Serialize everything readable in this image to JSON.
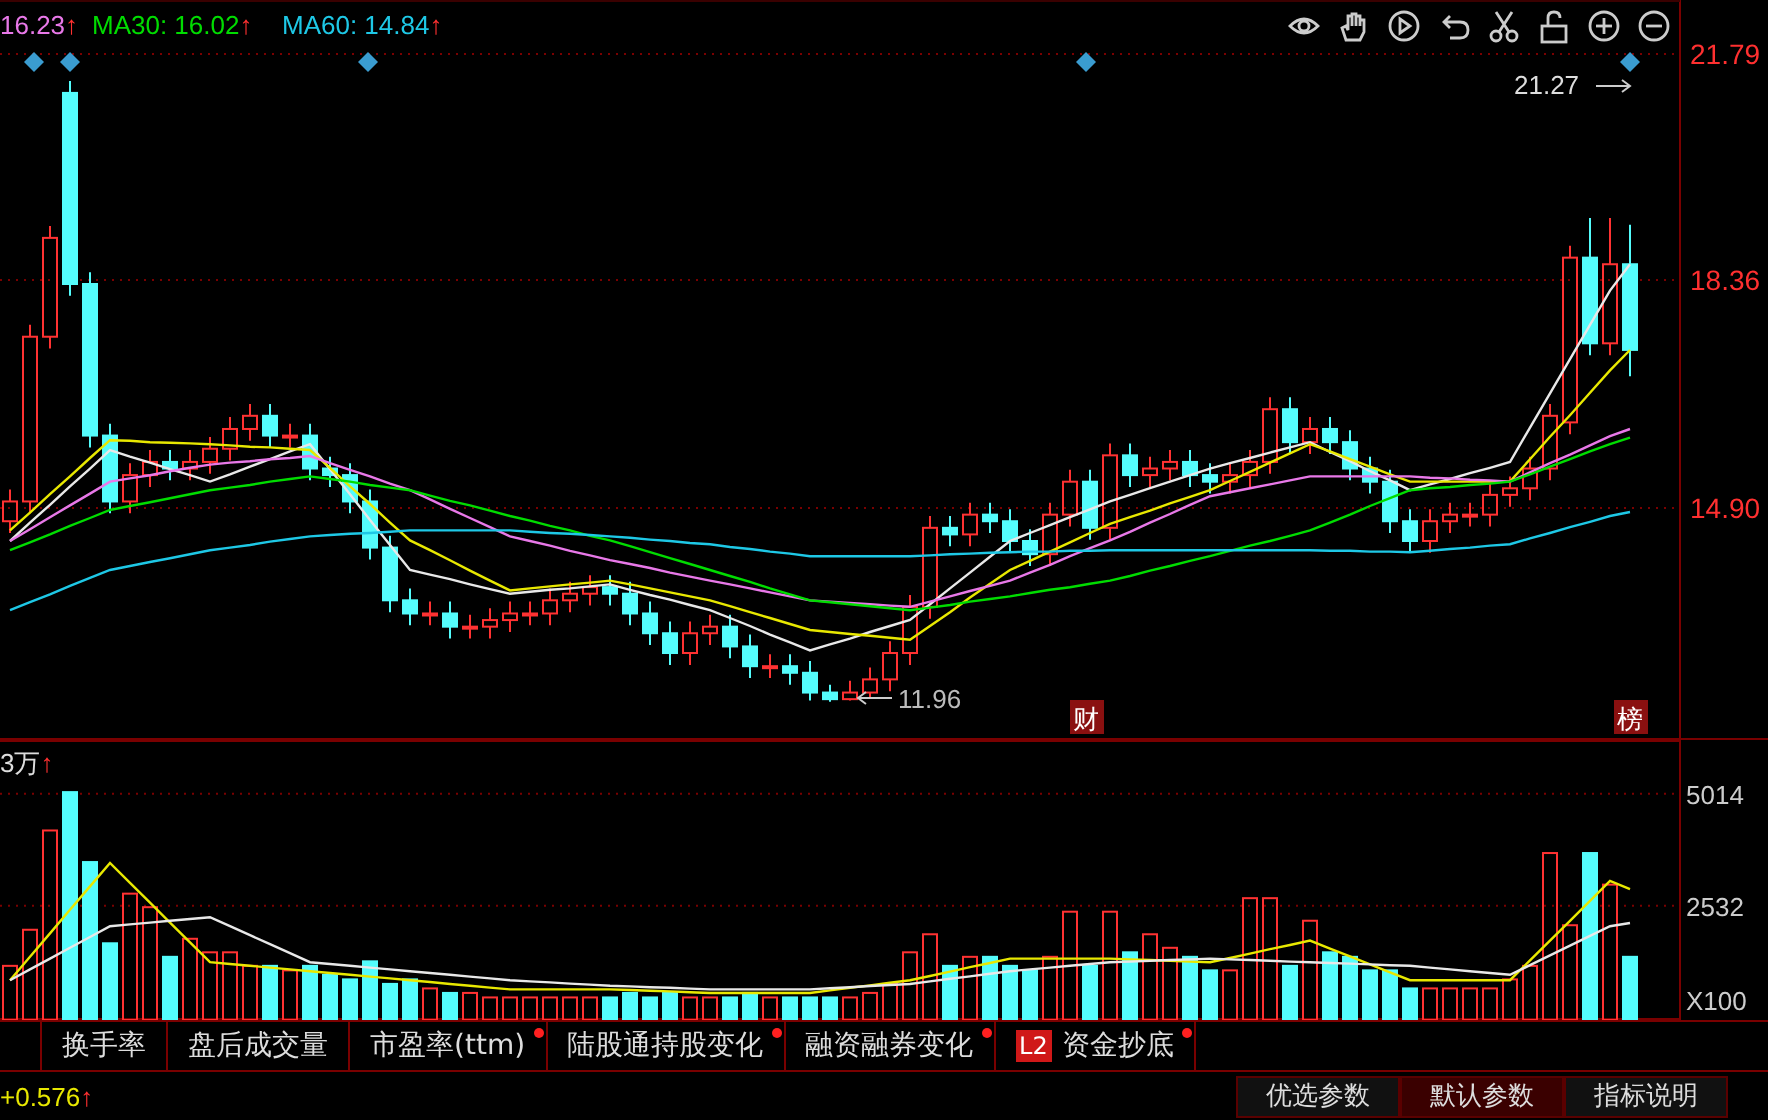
{
  "legend": [
    {
      "text": "16.23",
      "arrow": "↑",
      "color": "#e878e8"
    },
    {
      "text": "MA30: 16.02",
      "arrow": "↑",
      "color": "#00dc00"
    },
    {
      "text": "MA60: 14.84",
      "arrow": "↑",
      "color": "#1ec8e6"
    }
  ],
  "price_chart": {
    "chart_data": {
      "type": "candlestick",
      "ylim": [
        11.38,
        22.61
      ],
      "yticks": [
        {
          "value": 21.79,
          "label": "21.79"
        },
        {
          "value": 18.36,
          "label": "18.36"
        },
        {
          "value": 14.9,
          "label": "14.90"
        }
      ],
      "categories": [
        null,
        null,
        null,
        null,
        null,
        null,
        null,
        null,
        null,
        null,
        null,
        null,
        null,
        null,
        null,
        null,
        null,
        null,
        null,
        null,
        null,
        null,
        null,
        null,
        null,
        null,
        null,
        null,
        null,
        null,
        null,
        null,
        null,
        null,
        null,
        null,
        null,
        null,
        null,
        null,
        null,
        null,
        null,
        null,
        null,
        null,
        null,
        null,
        null,
        null,
        null,
        null,
        null,
        null,
        null,
        null,
        null,
        null,
        null,
        null,
        null,
        null,
        null,
        null,
        null,
        null,
        null,
        null,
        null,
        null,
        null,
        null,
        null,
        null,
        null,
        null,
        null,
        null,
        null,
        null,
        null,
        null
      ],
      "ohlc": [
        [
          14.7,
          15.18,
          14.52,
          15.0
        ],
        [
          15.0,
          17.68,
          14.82,
          17.5
        ],
        [
          17.5,
          19.18,
          17.32,
          19.0
        ],
        [
          21.2,
          21.38,
          18.12,
          18.3
        ],
        [
          18.3,
          18.48,
          15.82,
          16.0
        ],
        [
          16.0,
          16.18,
          14.82,
          15.0
        ],
        [
          15.0,
          15.58,
          14.82,
          15.4
        ],
        [
          15.4,
          15.78,
          15.22,
          15.6
        ],
        [
          15.6,
          15.78,
          15.32,
          15.5
        ],
        [
          15.5,
          15.78,
          15.32,
          15.6
        ],
        [
          15.6,
          15.98,
          15.42,
          15.8
        ],
        [
          15.8,
          16.28,
          15.62,
          16.1
        ],
        [
          16.1,
          16.48,
          15.92,
          16.3
        ],
        [
          16.3,
          16.48,
          15.82,
          16.0
        ],
        [
          16.0,
          16.18,
          15.82,
          16.0
        ],
        [
          16.0,
          16.18,
          15.32,
          15.5
        ],
        [
          15.5,
          15.68,
          15.22,
          15.4
        ],
        [
          15.4,
          15.58,
          14.82,
          15.0
        ],
        [
          15.0,
          15.18,
          14.12,
          14.3
        ],
        [
          14.3,
          14.48,
          13.32,
          13.5
        ],
        [
          13.5,
          13.68,
          13.12,
          13.3
        ],
        [
          13.3,
          13.48,
          13.12,
          13.3
        ],
        [
          13.3,
          13.48,
          12.92,
          13.1
        ],
        [
          13.1,
          13.28,
          12.92,
          13.1
        ],
        [
          13.1,
          13.38,
          12.92,
          13.2
        ],
        [
          13.2,
          13.48,
          13.02,
          13.3
        ],
        [
          13.3,
          13.48,
          13.12,
          13.3
        ],
        [
          13.3,
          13.68,
          13.12,
          13.5
        ],
        [
          13.5,
          13.78,
          13.32,
          13.6
        ],
        [
          13.6,
          13.88,
          13.42,
          13.7
        ],
        [
          13.7,
          13.88,
          13.42,
          13.6
        ],
        [
          13.6,
          13.78,
          13.12,
          13.3
        ],
        [
          13.3,
          13.48,
          12.82,
          13.0
        ],
        [
          13.0,
          13.18,
          12.52,
          12.7
        ],
        [
          12.7,
          13.18,
          12.52,
          13.0
        ],
        [
          13.0,
          13.28,
          12.82,
          13.1
        ],
        [
          13.1,
          13.28,
          12.62,
          12.8
        ],
        [
          12.8,
          12.98,
          12.32,
          12.5
        ],
        [
          12.5,
          12.68,
          12.32,
          12.5
        ],
        [
          12.5,
          12.68,
          12.22,
          12.4
        ],
        [
          12.4,
          12.58,
          11.98,
          12.1
        ],
        [
          12.1,
          12.22,
          11.96,
          12.0
        ],
        [
          12.0,
          12.28,
          11.98,
          12.1
        ],
        [
          12.1,
          12.48,
          12.02,
          12.3
        ],
        [
          12.3,
          12.88,
          12.12,
          12.7
        ],
        [
          12.7,
          13.58,
          12.52,
          13.4
        ],
        [
          13.4,
          14.78,
          13.22,
          14.6
        ],
        [
          14.6,
          14.78,
          14.32,
          14.5
        ],
        [
          14.5,
          14.98,
          14.32,
          14.8
        ],
        [
          14.8,
          14.98,
          14.52,
          14.7
        ],
        [
          14.7,
          14.88,
          14.22,
          14.4
        ],
        [
          14.4,
          14.58,
          14.02,
          14.2
        ],
        [
          14.2,
          14.98,
          14.02,
          14.8
        ],
        [
          14.8,
          15.48,
          14.62,
          15.3
        ],
        [
          15.3,
          15.48,
          14.42,
          14.6
        ],
        [
          14.6,
          15.88,
          14.42,
          15.7
        ],
        [
          15.7,
          15.88,
          15.22,
          15.4
        ],
        [
          15.4,
          15.68,
          15.22,
          15.5
        ],
        [
          15.5,
          15.78,
          15.32,
          15.6
        ],
        [
          15.6,
          15.78,
          15.22,
          15.4
        ],
        [
          15.4,
          15.58,
          15.12,
          15.3
        ],
        [
          15.3,
          15.58,
          15.12,
          15.4
        ],
        [
          15.4,
          15.78,
          15.22,
          15.6
        ],
        [
          15.6,
          16.58,
          15.42,
          16.4
        ],
        [
          16.4,
          16.58,
          15.72,
          15.9
        ],
        [
          15.9,
          16.28,
          15.72,
          16.1
        ],
        [
          16.1,
          16.28,
          15.72,
          15.9
        ],
        [
          15.9,
          16.08,
          15.32,
          15.5
        ],
        [
          15.5,
          15.68,
          15.12,
          15.3
        ],
        [
          15.3,
          15.48,
          14.52,
          14.7
        ],
        [
          14.7,
          14.88,
          14.22,
          14.4
        ],
        [
          14.4,
          14.88,
          14.22,
          14.7
        ],
        [
          14.7,
          14.98,
          14.52,
          14.8
        ],
        [
          14.8,
          14.98,
          14.62,
          14.8
        ],
        [
          14.8,
          15.28,
          14.62,
          15.1
        ],
        [
          15.1,
          15.38,
          14.92,
          15.2
        ],
        [
          15.2,
          15.68,
          15.02,
          15.5
        ],
        [
          15.5,
          16.48,
          15.32,
          16.3
        ],
        [
          16.2,
          18.88,
          16.02,
          18.7
        ],
        [
          18.7,
          19.3,
          17.22,
          17.4
        ],
        [
          17.4,
          19.3,
          17.22,
          18.6
        ],
        [
          18.6,
          19.2,
          16.9,
          17.3
        ]
      ],
      "series": [
        {
          "type": "line",
          "color": "#e8e8e8",
          "values": [
            14.4,
            14.68,
            14.95,
            15.23,
            15.5,
            15.78,
            15.68,
            15.59,
            15.49,
            15.4,
            15.3,
            15.41,
            15.53,
            15.64,
            15.76,
            15.87,
            15.49,
            15.11,
            14.72,
            14.34,
            13.96,
            13.89,
            13.82,
            13.74,
            13.67,
            13.6,
            13.63,
            13.66,
            13.68,
            13.71,
            13.74,
            13.66,
            13.58,
            13.51,
            13.43,
            13.35,
            13.23,
            13.11,
            12.98,
            12.86,
            12.74,
            12.83,
            12.92,
            13.02,
            13.11,
            13.2,
            13.44,
            13.68,
            13.92,
            14.16,
            14.4,
            14.52,
            14.64,
            14.76,
            14.88,
            15.0,
            15.1,
            15.2,
            15.3,
            15.4,
            15.5,
            15.58,
            15.66,
            15.74,
            15.82,
            15.9,
            15.75,
            15.61,
            15.46,
            15.32,
            15.17,
            15.26,
            15.34,
            15.43,
            15.51,
            15.6,
            16.12,
            16.64,
            17.16,
            17.68,
            18.2,
            18.6
          ]
        },
        {
          "type": "line",
          "color": "#e8e800",
          "values": [
            14.56,
            14.83,
            15.11,
            15.38,
            15.66,
            15.93,
            15.92,
            15.9,
            15.89,
            15.88,
            15.87,
            15.85,
            15.83,
            15.82,
            15.8,
            15.78,
            15.51,
            15.23,
            14.96,
            14.68,
            14.41,
            14.26,
            14.11,
            13.95,
            13.8,
            13.65,
            13.68,
            13.71,
            13.74,
            13.77,
            13.8,
            13.74,
            13.68,
            13.62,
            13.56,
            13.5,
            13.41,
            13.32,
            13.23,
            13.14,
            13.05,
            13.02,
            12.99,
            12.96,
            12.93,
            12.9,
            13.11,
            13.32,
            13.54,
            13.75,
            13.96,
            14.1,
            14.24,
            14.38,
            14.52,
            14.66,
            14.76,
            14.86,
            14.97,
            15.07,
            15.17,
            15.31,
            15.45,
            15.59,
            15.73,
            15.87,
            15.76,
            15.64,
            15.53,
            15.41,
            15.3,
            15.3,
            15.3,
            15.3,
            15.3,
            15.3,
            15.64,
            15.98,
            16.31,
            16.65,
            16.99,
            17.3
          ]
        },
        {
          "type": "line",
          "color": "#e878e8",
          "values": [
            14.4,
            14.58,
            14.76,
            14.94,
            15.12,
            15.3,
            15.35,
            15.4,
            15.46,
            15.51,
            15.56,
            15.59,
            15.61,
            15.64,
            15.66,
            15.69,
            15.58,
            15.48,
            15.38,
            15.27,
            15.17,
            15.03,
            14.89,
            14.75,
            14.61,
            14.47,
            14.4,
            14.33,
            14.25,
            14.18,
            14.11,
            14.05,
            13.99,
            13.92,
            13.86,
            13.8,
            13.74,
            13.68,
            13.62,
            13.56,
            13.5,
            13.48,
            13.46,
            13.44,
            13.42,
            13.4,
            13.48,
            13.56,
            13.64,
            13.72,
            13.8,
            13.92,
            14.04,
            14.17,
            14.29,
            14.41,
            14.54,
            14.68,
            14.81,
            14.95,
            15.08,
            15.14,
            15.2,
            15.26,
            15.32,
            15.38,
            15.38,
            15.38,
            15.38,
            15.38,
            15.38,
            15.36,
            15.35,
            15.33,
            15.32,
            15.3,
            15.44,
            15.58,
            15.71,
            15.85,
            15.99,
            16.1
          ]
        },
        {
          "type": "line",
          "color": "#00dc00",
          "values": [
            14.26,
            14.38,
            14.5,
            14.63,
            14.75,
            14.87,
            14.93,
            14.99,
            15.05,
            15.11,
            15.17,
            15.21,
            15.25,
            15.3,
            15.34,
            15.38,
            15.34,
            15.3,
            15.25,
            15.21,
            15.17,
            15.09,
            15.01,
            14.94,
            14.86,
            14.78,
            14.71,
            14.63,
            14.56,
            14.48,
            14.41,
            14.32,
            14.23,
            14.14,
            14.05,
            13.96,
            13.87,
            13.78,
            13.68,
            13.59,
            13.5,
            13.47,
            13.44,
            13.41,
            13.38,
            13.35,
            13.39,
            13.43,
            13.48,
            13.52,
            13.56,
            13.61,
            13.66,
            13.7,
            13.75,
            13.8,
            13.87,
            13.95,
            14.02,
            14.1,
            14.17,
            14.25,
            14.33,
            14.4,
            14.48,
            14.56,
            14.68,
            14.8,
            14.93,
            15.05,
            15.17,
            15.2,
            15.22,
            15.25,
            15.27,
            15.3,
            15.41,
            15.53,
            15.64,
            15.76,
            15.87,
            15.97
          ]
        },
        {
          "type": "line",
          "color": "#1ec8e6",
          "values": [
            13.35,
            13.47,
            13.59,
            13.72,
            13.84,
            13.96,
            14.02,
            14.08,
            14.14,
            14.2,
            14.26,
            14.3,
            14.34,
            14.39,
            14.43,
            14.47,
            14.49,
            14.51,
            14.52,
            14.54,
            14.56,
            14.56,
            14.56,
            14.56,
            14.56,
            14.56,
            14.54,
            14.52,
            14.51,
            14.49,
            14.47,
            14.45,
            14.42,
            14.4,
            14.37,
            14.35,
            14.31,
            14.28,
            14.24,
            14.21,
            14.17,
            14.17,
            14.17,
            14.17,
            14.17,
            14.17,
            14.18,
            14.2,
            14.21,
            14.22,
            14.23,
            14.24,
            14.24,
            14.25,
            14.25,
            14.26,
            14.26,
            14.26,
            14.26,
            14.26,
            14.26,
            14.26,
            14.26,
            14.26,
            14.26,
            14.26,
            14.25,
            14.25,
            14.24,
            14.24,
            14.23,
            14.25,
            14.28,
            14.3,
            14.33,
            14.35,
            14.44,
            14.52,
            14.61,
            14.69,
            14.78,
            14.84
          ]
        }
      ]
    }
  },
  "high_marker": "21.27",
  "low_marker": "11.96",
  "event_badges": [
    {
      "text": "财"
    },
    {
      "text": "榜"
    }
  ],
  "volume": {
    "label": "3万",
    "arrow": "↑",
    "unit": "X100",
    "chart_data": {
      "type": "bar",
      "ylim": [
        0,
        6205
      ],
      "colors": [
        "#ff3232",
        "#ff3232",
        "#ff3232",
        "#54fcfc",
        "#54fcfc",
        "#54fcfc",
        "#ff3232",
        "#ff3232",
        "#54fcfc",
        "#ff3232",
        "#ff3232",
        "#ff3232",
        "#ff3232",
        "#54fcfc",
        "#ff3232",
        "#54fcfc",
        "#54fcfc",
        "#54fcfc",
        "#54fcfc",
        "#54fcfc",
        "#54fcfc",
        "#ff3232",
        "#54fcfc",
        "#ff3232",
        "#ff3232",
        "#ff3232",
        "#ff3232",
        "#ff3232",
        "#ff3232",
        "#ff3232",
        "#54fcfc",
        "#54fcfc",
        "#54fcfc",
        "#54fcfc",
        "#ff3232",
        "#ff3232",
        "#54fcfc",
        "#54fcfc",
        "#ff3232",
        "#54fcfc",
        "#54fcfc",
        "#54fcfc",
        "#ff3232",
        "#ff3232",
        "#ff3232",
        "#ff3232",
        "#ff3232",
        "#54fcfc",
        "#ff3232",
        "#54fcfc",
        "#54fcfc",
        "#54fcfc",
        "#ff3232",
        "#ff3232",
        "#54fcfc",
        "#ff3232",
        "#54fcfc",
        "#ff3232",
        "#ff3232",
        "#54fcfc",
        "#54fcfc",
        "#ff3232",
        "#ff3232",
        "#ff3232",
        "#54fcfc",
        "#ff3232",
        "#54fcfc",
        "#54fcfc",
        "#54fcfc",
        "#54fcfc",
        "#54fcfc",
        "#ff3232",
        "#ff3232",
        "#ff3232",
        "#ff3232",
        "#ff3232",
        "#ff3232",
        "#ff3232",
        "#ff3232",
        "#54fcfc",
        "#ff3232",
        "#54fcfc"
      ],
      "yticks": [
        {
          "value": 5014,
          "label": "5014"
        },
        {
          "value": 2532,
          "label": "2532"
        }
      ],
      "categories": [
        null,
        null,
        null,
        null,
        null,
        null,
        null,
        null,
        null,
        null,
        null,
        null,
        null,
        null,
        null,
        null,
        null,
        null,
        null,
        null,
        null,
        null,
        null,
        null,
        null,
        null,
        null,
        null,
        null,
        null,
        null,
        null,
        null,
        null,
        null,
        null,
        null,
        null,
        null,
        null,
        null,
        null,
        null,
        null,
        null,
        null,
        null,
        null,
        null,
        null,
        null,
        null,
        null,
        null,
        null,
        null,
        null,
        null,
        null,
        null,
        null,
        null,
        null,
        null,
        null,
        null,
        null,
        null,
        null,
        null,
        null,
        null,
        null,
        null,
        null,
        null,
        null,
        null,
        null,
        null,
        null,
        null
      ],
      "values": [
        1200,
        2000,
        4200,
        5050,
        3500,
        1700,
        2800,
        2500,
        1400,
        1800,
        1500,
        1500,
        1200,
        1200,
        1100,
        1200,
        1000,
        900,
        1300,
        800,
        900,
        700,
        600,
        600,
        500,
        500,
        500,
        500,
        500,
        500,
        500,
        600,
        500,
        600,
        500,
        500,
        500,
        600,
        500,
        500,
        500,
        500,
        500,
        600,
        800,
        1500,
        1900,
        1200,
        1400,
        1400,
        1200,
        1100,
        1400,
        2400,
        1200,
        2400,
        1500,
        1900,
        1600,
        1400,
        1100,
        1100,
        2700,
        2700,
        1200,
        2200,
        1500,
        1400,
        1100,
        1100,
        700,
        700,
        700,
        700,
        700,
        900,
        1200,
        3700,
        2100,
        3700,
        3000,
        1400
      ],
      "series": [
        {
          "type": "line",
          "color": "#e8e800",
          "values": [
            880,
            1400,
            1920,
            2440,
            2960,
            3480,
            3040,
            2600,
            2160,
            1720,
            1280,
            1240,
            1200,
            1160,
            1120,
            1080,
            1040,
            1000,
            960,
            920,
            880,
            840,
            800,
            760,
            720,
            680,
            680,
            680,
            680,
            680,
            680,
            664,
            648,
            632,
            616,
            600,
            600,
            600,
            600,
            600,
            600,
            656,
            712,
            768,
            824,
            880,
            976,
            1072,
            1168,
            1264,
            1360,
            1360,
            1360,
            1360,
            1360,
            1360,
            1344,
            1328,
            1312,
            1296,
            1280,
            1376,
            1472,
            1568,
            1664,
            1760,
            1584,
            1408,
            1232,
            1056,
            880,
            880,
            880,
            880,
            880,
            880,
            1320,
            1760,
            2200,
            2640,
            3080,
            2900
          ]
        },
        {
          "type": "line",
          "color": "#e8e8e8",
          "values": [
            880,
            1120,
            1360,
            1600,
            1840,
            2080,
            2120,
            2160,
            2200,
            2240,
            2280,
            2080,
            1880,
            1680,
            1480,
            1280,
            1240,
            1200,
            1160,
            1120,
            1080,
            1040,
            1000,
            960,
            920,
            880,
            856,
            832,
            808,
            784,
            760,
            744,
            728,
            712,
            696,
            680,
            680,
            680,
            680,
            680,
            680,
            704,
            728,
            752,
            776,
            800,
            856,
            912,
            968,
            1024,
            1080,
            1120,
            1160,
            1200,
            1240,
            1280,
            1296,
            1312,
            1328,
            1344,
            1360,
            1344,
            1328,
            1312,
            1296,
            1280,
            1264,
            1248,
            1232,
            1216,
            1200,
            1160,
            1120,
            1080,
            1040,
            1000,
            1216,
            1432,
            1648,
            1864,
            2080,
            2150
          ]
        }
      ]
    }
  },
  "tabs": [
    {
      "label": "换手率",
      "dot": false
    },
    {
      "label": "盘后成交量",
      "dot": false
    },
    {
      "label": "市盈率(ttm)",
      "dot": true
    },
    {
      "label": "陆股通持股变化",
      "dot": true
    },
    {
      "label": "融资融券变化",
      "dot": true
    },
    {
      "label": "资金抄底",
      "badge": "L2",
      "dot": true
    }
  ],
  "footer": {
    "value": "+0.576",
    "arrow": "↑",
    "tabs": [
      {
        "label": "优选参数",
        "selected": false
      },
      {
        "label": "默认参数",
        "selected": true
      },
      {
        "label": "指标说明",
        "selected": false
      }
    ]
  }
}
